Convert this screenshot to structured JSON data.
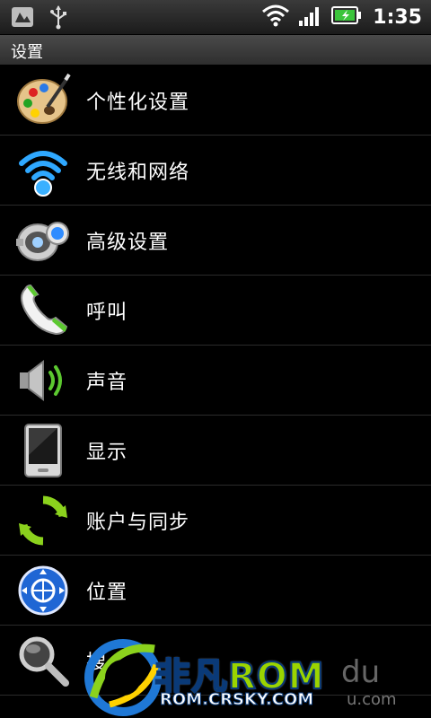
{
  "status_bar": {
    "time": "1:35",
    "left_icons": [
      "notification-icon",
      "usb-icon"
    ],
    "right_icons": [
      "wifi-icon",
      "signal-icon",
      "battery-icon"
    ],
    "battery_color": "#3bc43b"
  },
  "header": {
    "title": "设置"
  },
  "settings": {
    "items": [
      {
        "label": "个性化设置",
        "icon": "palette-icon"
      },
      {
        "label": "无线和网络",
        "icon": "wifi-signal-icon"
      },
      {
        "label": "高级设置",
        "icon": "advanced-settings-icon"
      },
      {
        "label": "呼叫",
        "icon": "phone-icon"
      },
      {
        "label": "声音",
        "icon": "speaker-icon"
      },
      {
        "label": "显示",
        "icon": "display-icon"
      },
      {
        "label": "账户与同步",
        "icon": "sync-icon"
      },
      {
        "label": "位置",
        "icon": "location-icon"
      },
      {
        "label": "搜",
        "icon": "search-icon"
      }
    ]
  },
  "watermark": {
    "brand": "非凡ROM",
    "url": "ROM.CRSKY.COM",
    "partial_right": "du",
    "partial_right_sub": "u.com"
  }
}
